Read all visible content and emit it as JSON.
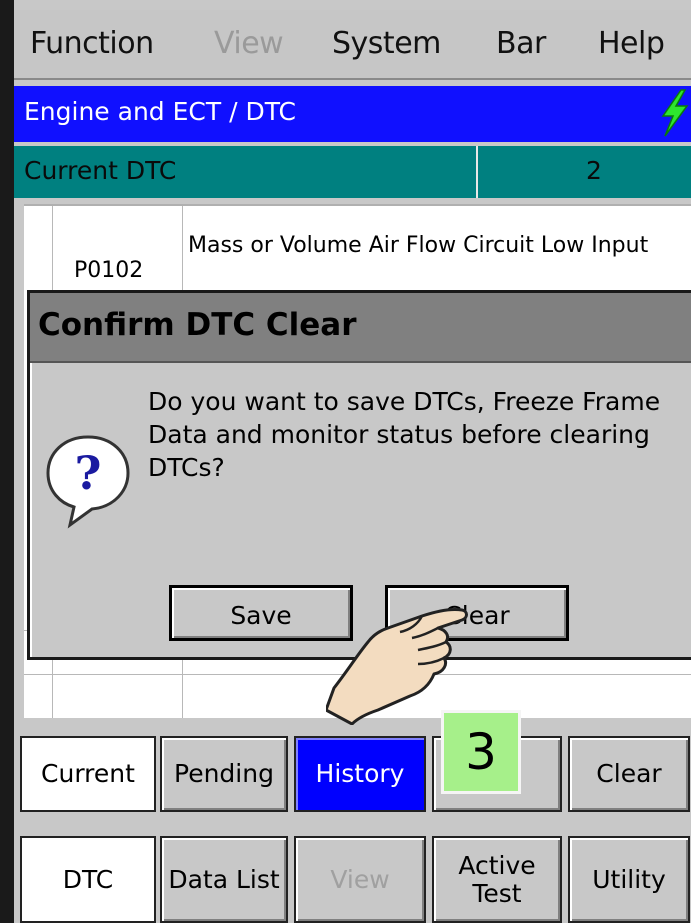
{
  "menu": {
    "items": [
      {
        "label": "Function",
        "enabled": true
      },
      {
        "label": "View",
        "enabled": false
      },
      {
        "label": "System",
        "enabled": true
      },
      {
        "label": "Bar",
        "enabled": true
      },
      {
        "label": "Help",
        "enabled": true
      }
    ]
  },
  "title": "Engine and ECT / DTC",
  "dtc_header": {
    "label": "Current DTC",
    "count": "2"
  },
  "dtc_rows": [
    {
      "code": "P0102",
      "description": "Mass or Volume Air Flow Circuit Low Input"
    }
  ],
  "dialog": {
    "title": "Confirm DTC Clear",
    "message": "Do you want to save DTCs, Freeze Frame Data and monitor status before clearing DTCs?",
    "save_label": "Save",
    "clear_label": "Clear"
  },
  "tabs_row1": {
    "current": "Current",
    "pending": "Pending",
    "history": "History",
    "clear": "Clear"
  },
  "tabs_row2": {
    "dtc": "DTC",
    "data_list": "Data List",
    "view": "View",
    "active_test": "Active Test",
    "utility": "Utility"
  },
  "step_badge": "3",
  "colors": {
    "title_bar": "#1010ff",
    "dtc_header": "#008080",
    "history_tab": "#0000ff",
    "step_badge": "#a6f08a"
  }
}
